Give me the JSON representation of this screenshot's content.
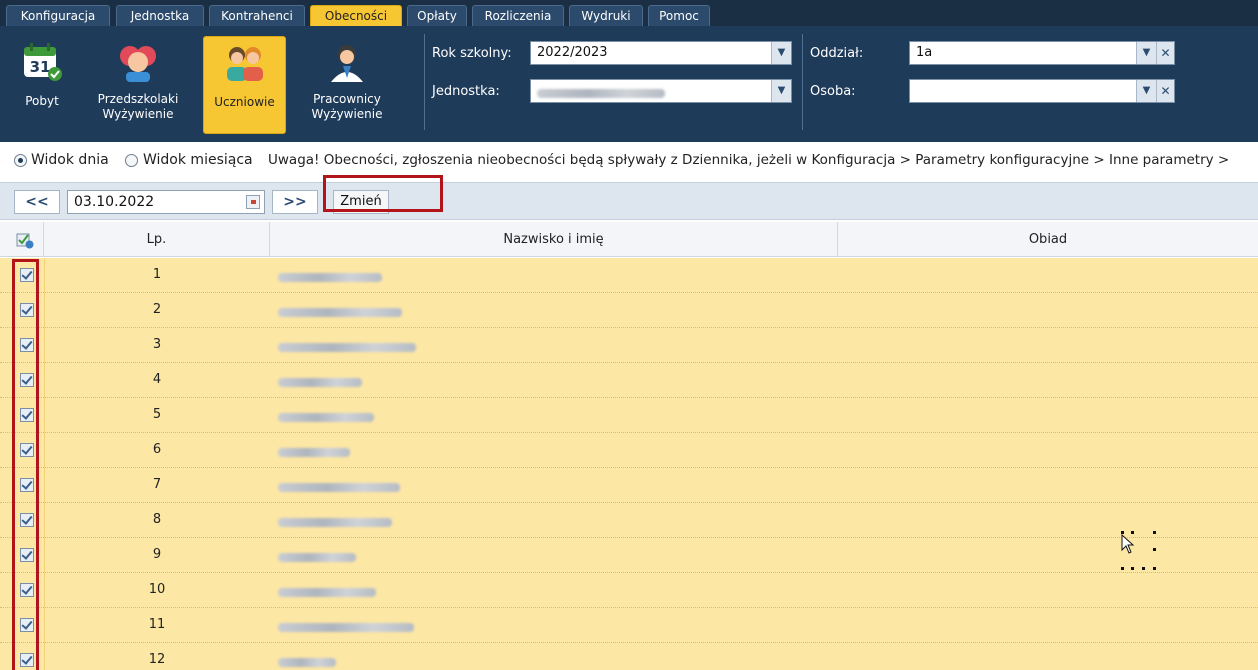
{
  "menu": {
    "tabs": [
      {
        "label": "Konfiguracja"
      },
      {
        "label": "Jednostka"
      },
      {
        "label": "Kontrahenci"
      },
      {
        "label": "Obecności"
      },
      {
        "label": "Opłaty"
      },
      {
        "label": "Rozliczenia"
      },
      {
        "label": "Wydruki"
      },
      {
        "label": "Pomoc"
      }
    ],
    "active_tab": "Obecności"
  },
  "ribbon": {
    "calendar_day": "31",
    "buttons": [
      {
        "label": "Pobyt"
      },
      {
        "label": "Przedszkolaki\nWyżywienie"
      },
      {
        "label": "Uczniowie"
      },
      {
        "label": "Pracownicy\nWyżywienie"
      }
    ],
    "active_button": "Uczniowie"
  },
  "filters": {
    "school_year_label": "Rok szkolny:",
    "school_year_value": "2022/2023",
    "unit_label": "Jednostka:",
    "class_label": "Oddział:",
    "class_value": "1a",
    "person_label": "Osoba:"
  },
  "info": {
    "day_view": "Widok dnia",
    "month_view": "Widok miesiąca",
    "notice": "Uwaga! Obecności, zgłoszenia nieobecności będą spływały z Dziennika, jeżeli w Konfiguracja > Parametry konfiguracyjne > Inne parametry >"
  },
  "datebar": {
    "prev": "<<",
    "next": ">>",
    "date": "03.10.2022",
    "change_label": "Zmień"
  },
  "grid": {
    "columns": {
      "lp": "Lp.",
      "name": "Nazwisko i imię",
      "meal": "Obiad"
    },
    "rows": [
      {
        "lp": "1",
        "checked": true
      },
      {
        "lp": "2",
        "checked": true
      },
      {
        "lp": "3",
        "checked": true
      },
      {
        "lp": "4",
        "checked": true
      },
      {
        "lp": "5",
        "checked": true
      },
      {
        "lp": "6",
        "checked": true
      },
      {
        "lp": "7",
        "checked": true
      },
      {
        "lp": "8",
        "checked": true
      },
      {
        "lp": "9",
        "checked": true
      },
      {
        "lp": "10",
        "checked": true
      },
      {
        "lp": "11",
        "checked": true
      },
      {
        "lp": "12",
        "checked": true
      }
    ]
  },
  "colors": {
    "header_bg": "#1f3b5a",
    "active_tab": "#f7c633",
    "row_bg": "#fde7a5",
    "annotation": "#b3141a"
  }
}
